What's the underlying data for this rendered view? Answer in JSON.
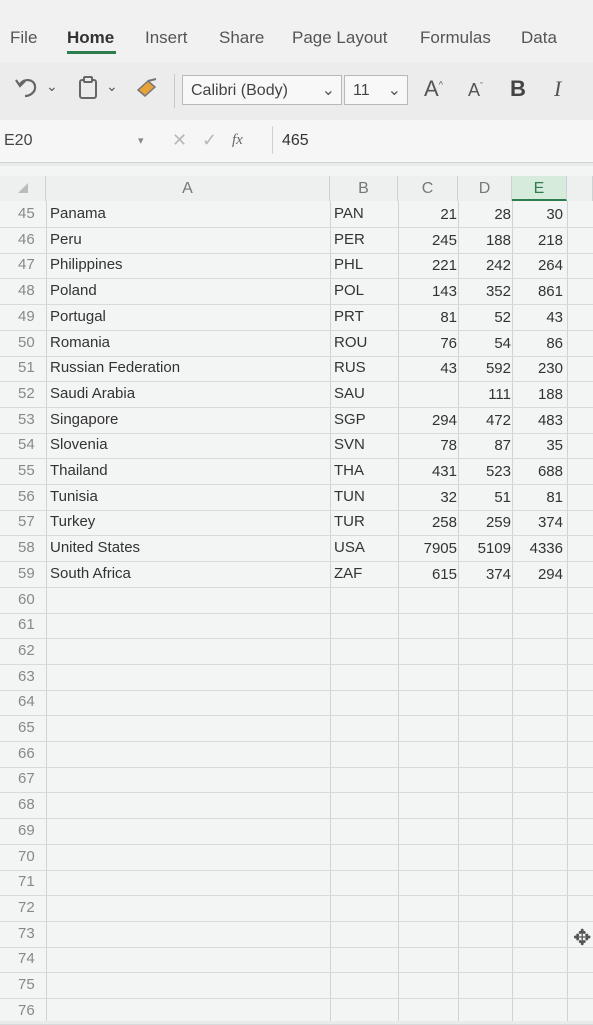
{
  "ribbon": {
    "tabs": [
      "File",
      "Home",
      "Insert",
      "Share",
      "Page Layout",
      "Formulas",
      "Data"
    ],
    "active_tab": "Home"
  },
  "toolbar": {
    "font_name": "Calibri (Body)",
    "font_size": "11",
    "grow_font": "A",
    "shrink_font": "A",
    "bold": "B",
    "italic": "I",
    "icons": [
      "undo-icon",
      "clipboard-icon",
      "format-painter-icon"
    ]
  },
  "formula_bar": {
    "cell_ref": "E20",
    "fx_label": "fx",
    "value": "465"
  },
  "sheet": {
    "columns": [
      "A",
      "B",
      "C",
      "D",
      "E"
    ],
    "active_column": "E",
    "rows": [
      {
        "num": "45",
        "a": "Panama",
        "b": "PAN",
        "c": "21",
        "d": "28",
        "e": "30"
      },
      {
        "num": "46",
        "a": "Peru",
        "b": "PER",
        "c": "245",
        "d": "188",
        "e": "218"
      },
      {
        "num": "47",
        "a": "Philippines",
        "b": "PHL",
        "c": "221",
        "d": "242",
        "e": "264"
      },
      {
        "num": "48",
        "a": "Poland",
        "b": "POL",
        "c": "143",
        "d": "352",
        "e": "861"
      },
      {
        "num": "49",
        "a": "Portugal",
        "b": "PRT",
        "c": "81",
        "d": "52",
        "e": "43"
      },
      {
        "num": "50",
        "a": "Romania",
        "b": "ROU",
        "c": "76",
        "d": "54",
        "e": "86"
      },
      {
        "num": "51",
        "a": "Russian Federation",
        "b": "RUS",
        "c": "43",
        "d": "592",
        "e": "230"
      },
      {
        "num": "52",
        "a": "Saudi Arabia",
        "b": "SAU",
        "c": "",
        "d": "111",
        "e": "188"
      },
      {
        "num": "53",
        "a": "Singapore",
        "b": "SGP",
        "c": "294",
        "d": "472",
        "e": "483"
      },
      {
        "num": "54",
        "a": "Slovenia",
        "b": "SVN",
        "c": "78",
        "d": "87",
        "e": "35"
      },
      {
        "num": "55",
        "a": "Thailand",
        "b": "THA",
        "c": "431",
        "d": "523",
        "e": "688"
      },
      {
        "num": "56",
        "a": "Tunisia",
        "b": "TUN",
        "c": "32",
        "d": "51",
        "e": "81"
      },
      {
        "num": "57",
        "a": "Turkey",
        "b": "TUR",
        "c": "258",
        "d": "259",
        "e": "374"
      },
      {
        "num": "58",
        "a": "United States",
        "b": "USA",
        "c": "7905",
        "d": "5109",
        "e": "4336"
      },
      {
        "num": "59",
        "a": "South Africa",
        "b": "ZAF",
        "c": "615",
        "d": "374",
        "e": "294"
      },
      {
        "num": "60",
        "a": "",
        "b": "",
        "c": "",
        "d": "",
        "e": ""
      },
      {
        "num": "61",
        "a": "",
        "b": "",
        "c": "",
        "d": "",
        "e": ""
      },
      {
        "num": "62",
        "a": "",
        "b": "",
        "c": "",
        "d": "",
        "e": ""
      },
      {
        "num": "63",
        "a": "",
        "b": "",
        "c": "",
        "d": "",
        "e": ""
      },
      {
        "num": "64",
        "a": "",
        "b": "",
        "c": "",
        "d": "",
        "e": ""
      },
      {
        "num": "65",
        "a": "",
        "b": "",
        "c": "",
        "d": "",
        "e": ""
      },
      {
        "num": "66",
        "a": "",
        "b": "",
        "c": "",
        "d": "",
        "e": ""
      },
      {
        "num": "67",
        "a": "",
        "b": "",
        "c": "",
        "d": "",
        "e": ""
      },
      {
        "num": "68",
        "a": "",
        "b": "",
        "c": "",
        "d": "",
        "e": ""
      },
      {
        "num": "69",
        "a": "",
        "b": "",
        "c": "",
        "d": "",
        "e": ""
      },
      {
        "num": "70",
        "a": "",
        "b": "",
        "c": "",
        "d": "",
        "e": ""
      },
      {
        "num": "71",
        "a": "",
        "b": "",
        "c": "",
        "d": "",
        "e": ""
      },
      {
        "num": "72",
        "a": "",
        "b": "",
        "c": "",
        "d": "",
        "e": ""
      },
      {
        "num": "73",
        "a": "",
        "b": "",
        "c": "",
        "d": "",
        "e": ""
      },
      {
        "num": "74",
        "a": "",
        "b": "",
        "c": "",
        "d": "",
        "e": ""
      },
      {
        "num": "75",
        "a": "",
        "b": "",
        "c": "",
        "d": "",
        "e": ""
      },
      {
        "num": "76",
        "a": "",
        "b": "",
        "c": "",
        "d": "",
        "e": ""
      }
    ]
  },
  "colors": {
    "accent": "#2e7d4f",
    "active_header_bg": "#d6ebdc"
  }
}
